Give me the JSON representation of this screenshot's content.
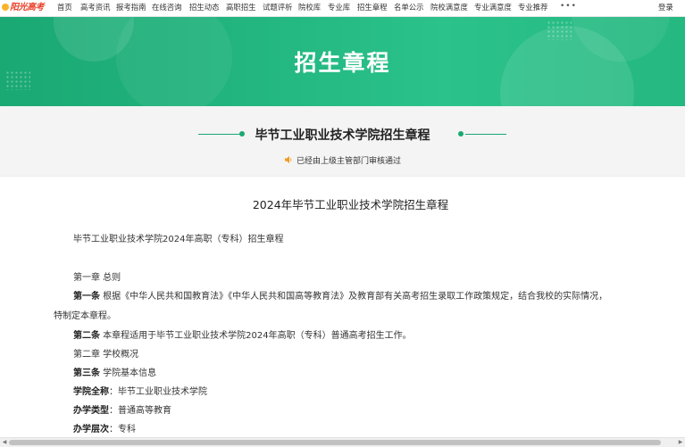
{
  "nav": {
    "logo_text": "阳光高考",
    "items": [
      "首页",
      "高考资讯",
      "报考指南",
      "在线咨询",
      "招生动态",
      "高职招生",
      "试题评析",
      "院校库",
      "专业库",
      "招生章程",
      "名单公示",
      "院校满意度",
      "专业满意度",
      "专业推荐"
    ],
    "more": "•••",
    "login": "登录"
  },
  "banner": {
    "title": "招生章程"
  },
  "header": {
    "doc_title": "毕节工业职业技术学院招生章程",
    "notice": "已经由上级主管部门审核通过"
  },
  "article": {
    "title": "2024年毕节工业职业技术学院招生章程",
    "lines": [
      {
        "bold": "",
        "text": "毕节工业职业技术学院2024年高职（专科）招生章程"
      },
      {
        "bold": "",
        "text": "第一章  总则"
      },
      {
        "bold": "第一条",
        "text": " 根据《中华人民共和国教育法》《中华人民共和国高等教育法》及教育部有关高考招生录取工作政策规定，结合我校的实际情况，"
      },
      {
        "bold": "",
        "text": "特制定本章程。"
      },
      {
        "bold": "第二条",
        "text": " 本章程适用于毕节工业职业技术学院2024年高职（专科）普通高考招生工作。"
      },
      {
        "bold": "",
        "text": "第二章  学校概况"
      },
      {
        "bold": "第三条",
        "text": " 学院基本信息"
      },
      {
        "bold": "学院全称",
        "text": "：毕节工业职业技术学院"
      },
      {
        "bold": "办学类型",
        "text": "：普通高等教育"
      },
      {
        "bold": "办学层次",
        "text": "：专科"
      }
    ]
  },
  "colors": {
    "brand_green": "#1aa873",
    "banner_text": "#ffffff",
    "logo_red": "#e8412b"
  }
}
